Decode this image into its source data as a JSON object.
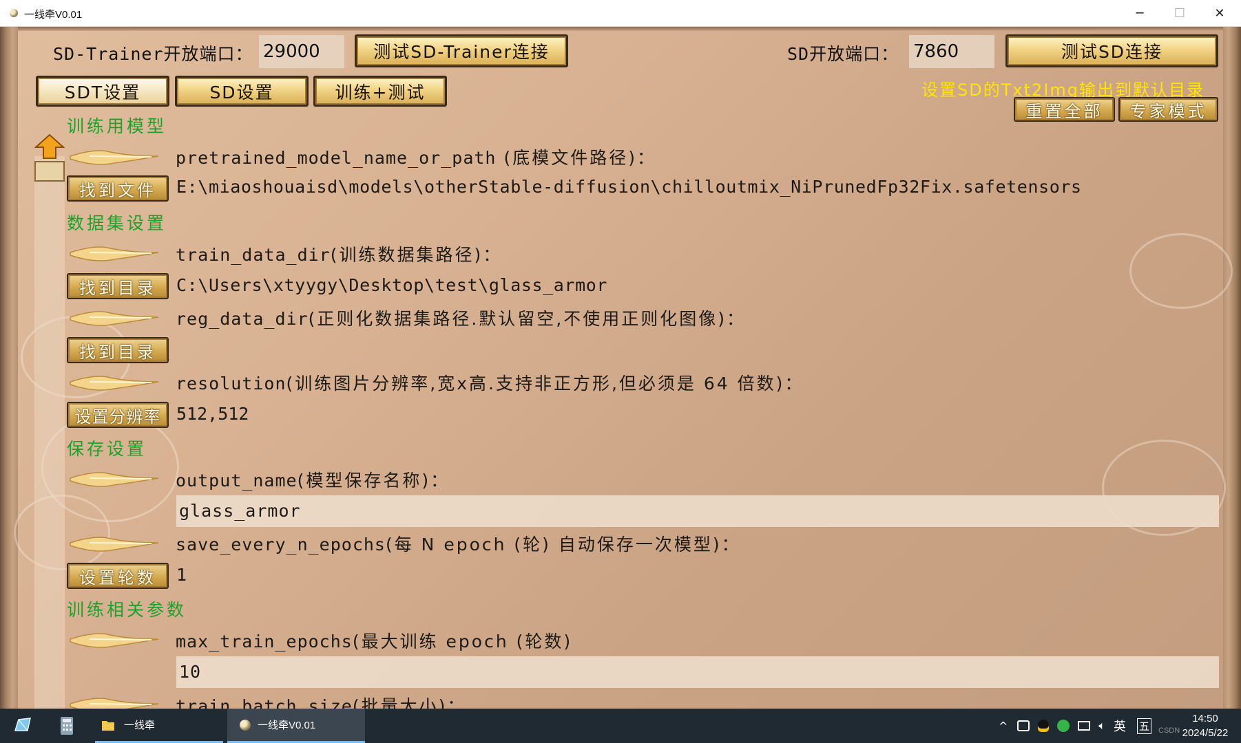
{
  "window": {
    "title": "一线牵V0.01",
    "minimize_glyph": "─",
    "maximize_glyph": "☐",
    "close_glyph": "✕"
  },
  "header": {
    "sdt_port_label": "SD-Trainer开放端口：",
    "sdt_port_value": "29000",
    "test_sdt_button": "测试SD-Trainer连接",
    "sd_port_label": "SD开放端口：",
    "sd_port_value": "7860",
    "test_sd_button": "测试SD连接"
  },
  "tabs": [
    {
      "label": "SDT设置",
      "active": true
    },
    {
      "label": "SD设置",
      "active": false
    },
    {
      "label": "训练+测试",
      "active": false
    }
  ],
  "notice": "设置SD的Txt2Img输出到默认目录",
  "actions": {
    "reset_all": "重置全部",
    "expert_mode": "专家模式"
  },
  "sections": {
    "model": "训练用模型",
    "dataset": "数据集设置",
    "save": "保存设置",
    "training": "训练相关参数"
  },
  "params": {
    "pretrained": {
      "name": "pretrained_model_name_or_path",
      "desc": " (底模文件路径)：",
      "button": "找到文件",
      "value": "E:\\miaoshouaisd\\models\\otherStable-diffusion\\chilloutmix_NiPrunedFp32Fix.safetensors"
    },
    "train_data_dir": {
      "name": "train_data_dir",
      "desc": "(训练数据集路径)：",
      "button": "找到目录",
      "value": "C:\\Users\\xtyygy\\Desktop\\test\\glass_armor"
    },
    "reg_data_dir": {
      "name": "reg_data_dir",
      "desc": "(正则化数据集路径.默认留空,不使用正则化图像)：",
      "button": "找到目录",
      "value": ""
    },
    "resolution": {
      "name": "resolution",
      "desc": "(训练图片分辨率,宽x高.支持非正方形,但必须是 64 倍数)：",
      "button": "设置分辨率",
      "value": "512,512"
    },
    "output_name": {
      "name": "output_name",
      "desc": "(模型保存名称)：",
      "value": "glass_armor"
    },
    "save_every_n_epochs": {
      "name": "save_every_n_epochs",
      "desc": "(每 N epoch (轮) 自动保存一次模型)：",
      "button": "设置轮数",
      "value": "1"
    },
    "max_train_epochs": {
      "name": "max_train_epochs",
      "desc": "(最大训练 epoch (轮数)",
      "value": "10"
    },
    "train_batch_size": {
      "name": "train_batch_size",
      "desc": "(批量大小)："
    }
  },
  "taskbar": {
    "folder_label": "一线牵",
    "app_label": "一线牵V0.01",
    "ime_label": "英",
    "input_label": "五",
    "time": "14:50",
    "date": "2024/5/22",
    "watermark": "CSDN"
  },
  "colors": {
    "background": "#d7b192",
    "section_green": "#1aa32a",
    "notice_yellow": "#ffe600",
    "button_gold": "#f1d486",
    "taskbar": "#1f2a33"
  }
}
